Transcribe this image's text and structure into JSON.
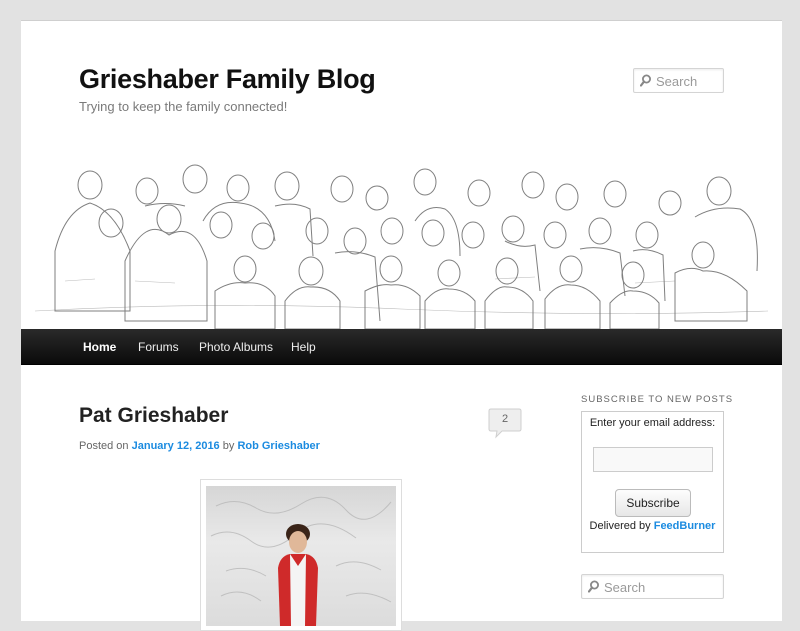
{
  "site": {
    "title": "Grieshaber Family Blog",
    "description": "Trying to keep the family connected!"
  },
  "header_search": {
    "placeholder": "Search"
  },
  "nav": {
    "items": [
      {
        "label": "Home",
        "active": true
      },
      {
        "label": "Forums",
        "active": false
      },
      {
        "label": "Photo Albums",
        "active": false
      },
      {
        "label": "Help",
        "active": false
      }
    ]
  },
  "post": {
    "title": "Pat Grieshaber",
    "comment_count": "2",
    "meta": {
      "prefix": "Posted on",
      "date": "January 12, 2016",
      "by": "by",
      "author": "Rob Grieshaber"
    }
  },
  "sidebar": {
    "subscribe": {
      "heading": "Subscribe to New Posts",
      "label": "Enter your email address:",
      "button": "Subscribe",
      "delivered_prefix": "Delivered by",
      "delivered_link": "FeedBurner"
    },
    "search": {
      "placeholder": "Search"
    }
  },
  "colors": {
    "link": "#1b8be0",
    "nav_bg": "#111111",
    "page_bg": "#e2e2e2"
  },
  "icons": [
    "search-icon",
    "comment-bubble-icon"
  ]
}
